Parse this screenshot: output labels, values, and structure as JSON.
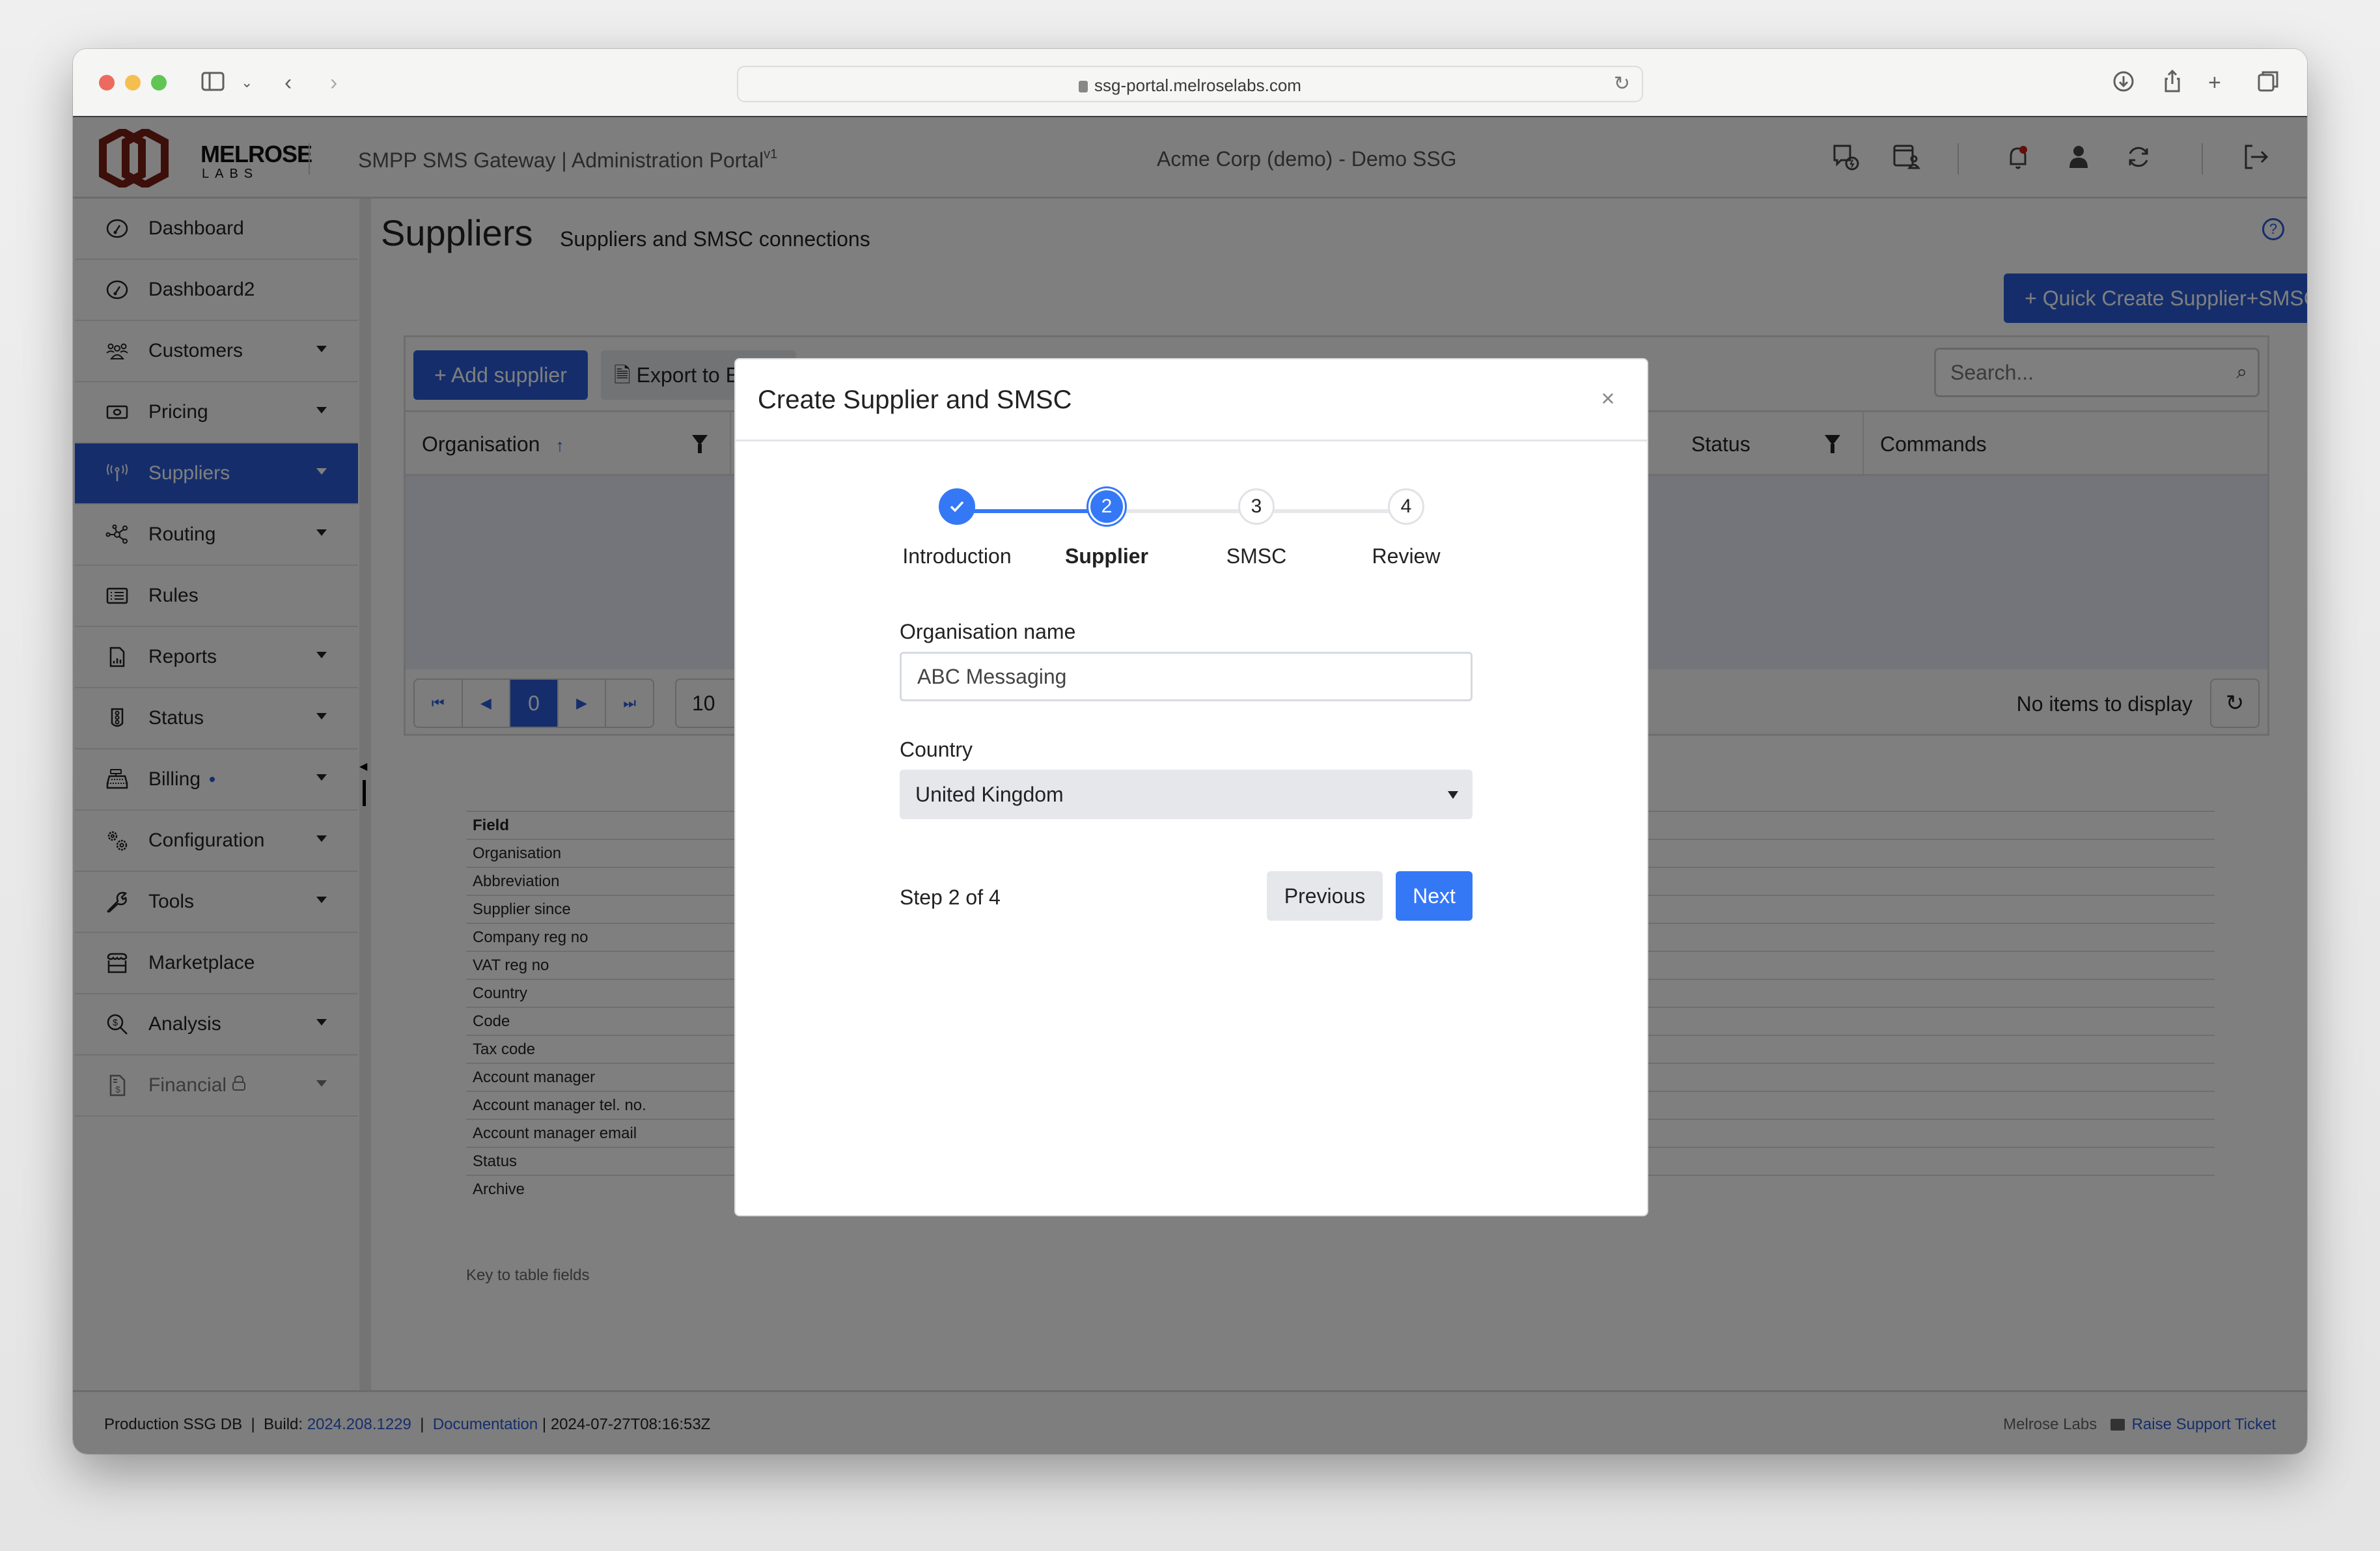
{
  "browser": {
    "url": "ssg-portal.melroselabs.com"
  },
  "header": {
    "logo_word": "MELROSE",
    "logo_sub": "LABS",
    "app_title": "SMPP SMS Gateway | Administration Portal",
    "app_version": "v1",
    "tenant": "Acme Corp (demo) - Demo SSG",
    "icons": [
      "api-icon",
      "portal-user-icon",
      "notifications-bell-icon",
      "user-profile-icon",
      "refresh-icon",
      "logout-icon"
    ]
  },
  "sidebar": {
    "items": [
      {
        "label": "Dashboard",
        "icon": "dashboard-gauge-icon",
        "caret": false
      },
      {
        "label": "Dashboard2",
        "icon": "dashboard-gauge-icon",
        "caret": false
      },
      {
        "label": "Customers",
        "icon": "people-icon",
        "caret": true
      },
      {
        "label": "Pricing",
        "icon": "cash-icon",
        "caret": true
      },
      {
        "label": "Suppliers",
        "icon": "broadcast-antenna-icon",
        "caret": true,
        "active": true
      },
      {
        "label": "Routing",
        "icon": "network-nodes-icon",
        "caret": true
      },
      {
        "label": "Rules",
        "icon": "list-icon",
        "caret": false
      },
      {
        "label": "Reports",
        "icon": "report-chart-icon",
        "caret": true
      },
      {
        "label": "Status",
        "icon": "traffic-light-icon",
        "caret": true
      },
      {
        "label": "Billing",
        "icon": "cash-register-icon",
        "caret": true,
        "dot": true
      },
      {
        "label": "Configuration",
        "icon": "gears-icon",
        "caret": true
      },
      {
        "label": "Tools",
        "icon": "wrench-icon",
        "caret": true
      },
      {
        "label": "Marketplace",
        "icon": "shop-icon",
        "caret": false
      },
      {
        "label": "Analysis",
        "icon": "search-dollar-icon",
        "caret": true
      },
      {
        "label": "Financial",
        "icon": "invoice-dollar-icon",
        "caret": true,
        "locked": true,
        "disabled": true
      }
    ]
  },
  "main": {
    "title": "Suppliers",
    "subtitle": "Suppliers and SMSC connections",
    "quick_create_label": "+ Quick Create Supplier+SMSC",
    "add_supplier_label": "+ Add supplier",
    "export_label": "Export to E",
    "search_placeholder": "Search...",
    "columns": [
      {
        "label": "Organisation",
        "sorted": "asc",
        "filter": true
      },
      {
        "label": "Status",
        "filter": true
      },
      {
        "label": "Commands",
        "filter": false
      }
    ],
    "pager": {
      "current_page": "0",
      "page_size": "10",
      "status": "No items to display"
    },
    "key_table": {
      "header": "Field",
      "rows": [
        "Organisation",
        "Abbreviation",
        "Supplier since",
        "Company reg no",
        "VAT reg no",
        "Country",
        "Code",
        "Tax code",
        "Account manager",
        "Account manager tel. no.",
        "Account manager email",
        "Status",
        "Archive"
      ],
      "caption": "Key to table fields"
    }
  },
  "footer": {
    "db": "Production SSG DB",
    "build_label": "Build:",
    "build": "2024.208.1229",
    "docs": "Documentation",
    "timestamp": "2024-07-27T08:16:53Z",
    "company": "Melrose Labs",
    "support": "Raise Support Ticket"
  },
  "modal": {
    "title": "Create Supplier and SMSC",
    "close": "×",
    "steps": [
      {
        "number": "1",
        "label": "Introduction",
        "state": "done"
      },
      {
        "number": "2",
        "label": "Supplier",
        "state": "current"
      },
      {
        "number": "3",
        "label": "SMSC",
        "state": "pending"
      },
      {
        "number": "4",
        "label": "Review",
        "state": "pending"
      }
    ],
    "org_label": "Organisation name",
    "org_value": "ABC Messaging",
    "country_label": "Country",
    "country_value": "United Kingdom",
    "step_counter": "Step 2 of 4",
    "previous_label": "Previous",
    "next_label": "Next"
  },
  "colors": {
    "primary": "#2a5cd6",
    "stepper_accent": "#3478f6",
    "logo": "#7a1e14"
  }
}
